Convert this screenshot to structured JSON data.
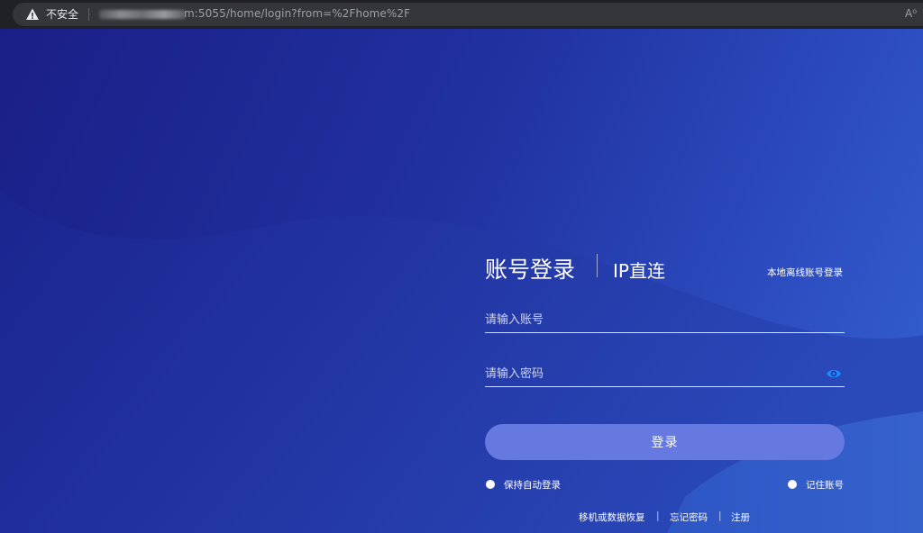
{
  "browser": {
    "security_label": "不安全",
    "url_visible": "m:5055/home/login?from=%2Fhome%2F",
    "reader_icon_text": "A⁰"
  },
  "login": {
    "tab_account": "账号登录",
    "tab_ip": "IP直连",
    "local_offline_link": "本地离线账号登录",
    "account_placeholder": "请输入账号",
    "password_placeholder": "请输入密码",
    "submit_label": "登录",
    "auto_login_label": "保持自动登录",
    "remember_label": "记住账号"
  },
  "footer": {
    "recover_label": "移机或数据恢复",
    "separator": "|",
    "forgot_label": "忘记密码",
    "register_label": "注册"
  },
  "colors": {
    "accent": "#1a8cff",
    "button": "#6579e0",
    "background_dark": "#1a1f86",
    "background_light": "#3462cf"
  },
  "icons": {
    "warning": "warning-triangle-icon",
    "eye": "eye-icon",
    "reader": "reader-mode-icon"
  }
}
